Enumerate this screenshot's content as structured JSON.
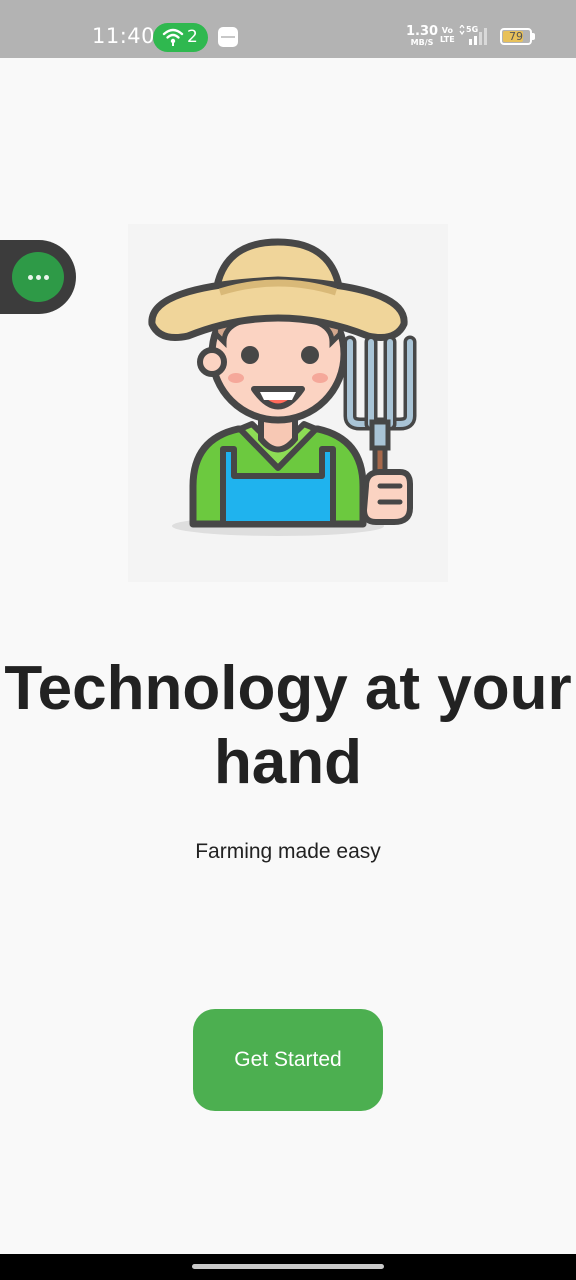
{
  "status_bar": {
    "time": "11:40",
    "hotspot_count": "2",
    "net_speed_value": "1.30",
    "net_speed_unit": "MB/S",
    "volte_top": "Vo",
    "volte_bottom": "LTE",
    "network_type": "5G",
    "battery_level": "79",
    "battery_fraction": 0.79
  },
  "floating_bubble": {
    "icon": "more-dots-icon"
  },
  "illustration": {
    "icon": "farmer-with-pitchfork-illustration"
  },
  "main": {
    "headline": "Technology at your hand",
    "subtitle": "Farming made easy",
    "cta_label": "Get Started"
  },
  "colors": {
    "accent": "#4caf50",
    "bubble": "#2e9a47",
    "hotspot": "#2fb84f",
    "text": "#222222"
  }
}
